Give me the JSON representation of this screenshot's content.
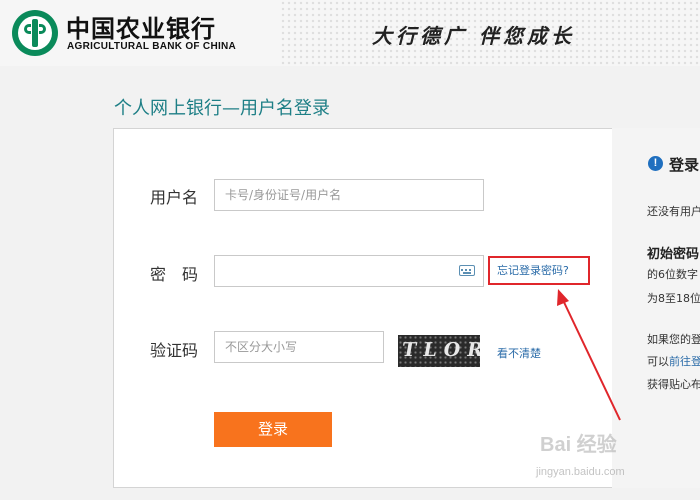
{
  "header": {
    "bank_name_cn": "中国农业银行",
    "bank_name_en": "AGRICULTURAL BANK OF CHINA",
    "slogan": "大行德广  伴您成长"
  },
  "page_title": "个人网上银行—用户名登录",
  "form": {
    "username_label": "用户名",
    "username_placeholder": "卡号/身份证号/用户名",
    "password_label": "密　码",
    "password_value": "",
    "forgot_link": "忘记登录密码?",
    "captcha_label": "验证码",
    "captcha_placeholder": "不区分大小写",
    "captcha_text": "TLOR",
    "refresh_link": "看不清楚",
    "login_button": "登录"
  },
  "info_panel": {
    "title": "登录",
    "line1": "还没有用户",
    "initial_password_title": "初始密码",
    "line2": "的6位数字",
    "line3": "为8至18位",
    "line4": "如果您的登",
    "line5_prefix": "可以",
    "line5_link": "前往登",
    "line6": "获得贴心布"
  },
  "watermark": {
    "main": "Bai 经验",
    "sub": "jingyan.baidu.com"
  },
  "colors": {
    "brand_green": "#0a8a5a",
    "title_teal": "#1e7f86",
    "login_orange": "#f8731d",
    "highlight_red": "#e0262b",
    "link_blue": "#2a6ba8"
  }
}
